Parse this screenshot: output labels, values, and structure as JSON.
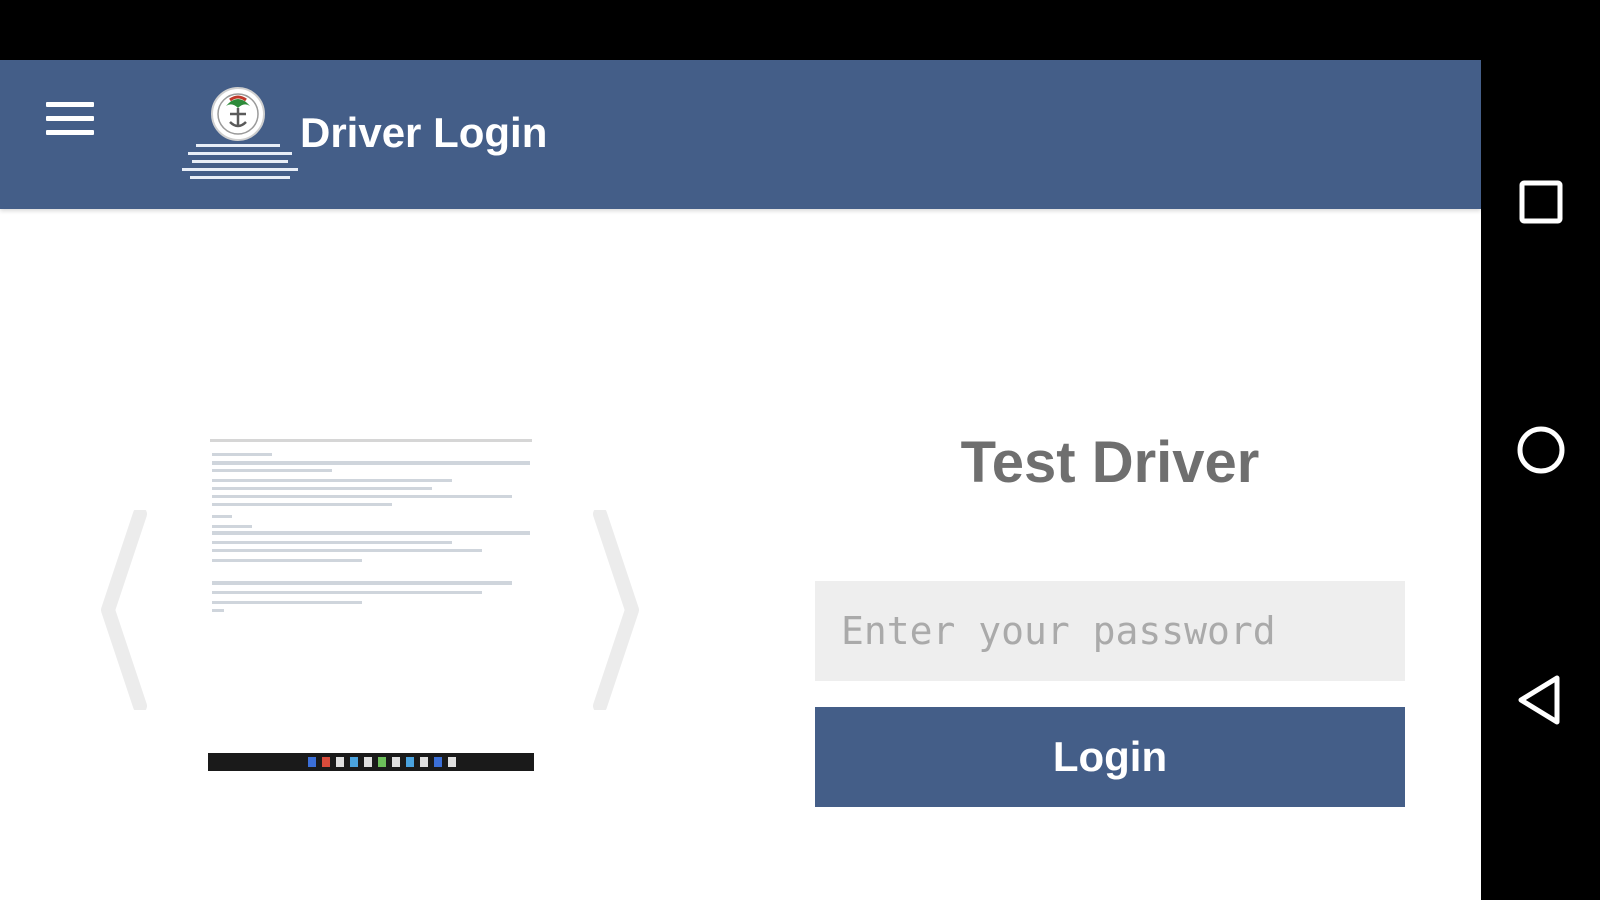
{
  "toolbar": {
    "title": "Driver Login",
    "menu_icon": "hamburger-menu-icon",
    "logo": "organization-logo"
  },
  "carousel": {
    "prev_icon": "chevron-left-icon",
    "next_icon": "chevron-right-icon",
    "slide": "screenshot-thumbnail"
  },
  "login": {
    "driver_name": "Test Driver",
    "password_placeholder": "Enter your password",
    "password_value": "",
    "login_label": "Login"
  },
  "nav": {
    "recent_icon": "square-recent-apps-icon",
    "home_icon": "circle-home-icon",
    "back_icon": "triangle-back-icon"
  },
  "colors": {
    "primary": "#445e88",
    "input_bg": "#eeeeee",
    "text_muted": "#6f6f6f",
    "caret": "#0d8a7c"
  }
}
